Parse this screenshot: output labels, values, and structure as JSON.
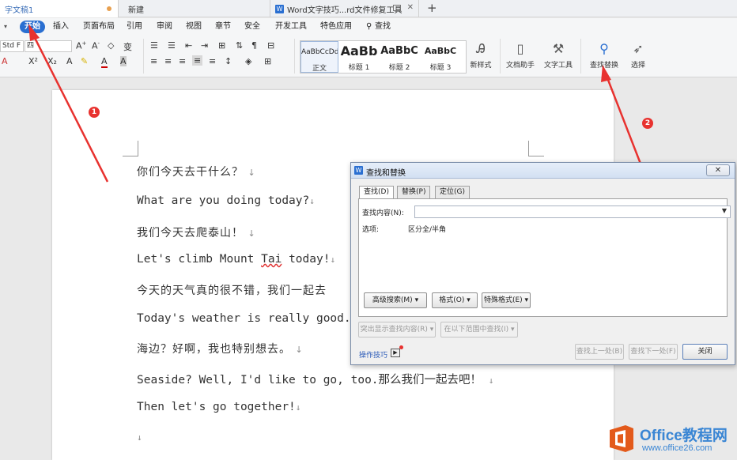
{
  "tabs": [
    {
      "label": "字文稿1",
      "active": true
    },
    {
      "label": "新建",
      "active": false
    },
    {
      "label": "Word文字技巧...rd文件修复工具",
      "active": false
    }
  ],
  "new_tab_glyph": "+",
  "menu": {
    "collapse_glyph": "▾",
    "items": [
      "开始",
      "插入",
      "页面布局",
      "引用",
      "审阅",
      "视图",
      "章节",
      "安全",
      "开发工具",
      "特色应用"
    ],
    "search_label": "查找"
  },
  "ribbon": {
    "font_name": "Std F",
    "font_size": "四",
    "styles": [
      {
        "preview": "AaBbCcDd",
        "name": "正文"
      },
      {
        "preview": "AaBb",
        "name": "标题 1"
      },
      {
        "preview": "AaBbC",
        "name": "标题 2"
      },
      {
        "preview": "AaBbC",
        "name": "标题 3"
      }
    ],
    "new_style_label": "新样式",
    "doc_helper_label": "文档助手",
    "text_tools_label": "文字工具",
    "find_replace_label": "查找替换",
    "select_label": "选择"
  },
  "document": {
    "lines": [
      {
        "text": "你们今天去干什么？",
        "cjk": true
      },
      {
        "text": "What are you doing today?",
        "cjk": false
      },
      {
        "text": "我们今天去爬泰山！",
        "cjk": true
      },
      {
        "text_before": "Let's climb Mount ",
        "squiggle": "Tai",
        "text_after": " today!"
      },
      {
        "text": "今天的天气真的很不错，我们一起去",
        "cjk": true
      },
      {
        "text": "Today's weather is really good. L",
        "cjk": false
      },
      {
        "text": "海边？好啊，我也特别想去。",
        "cjk": true
      },
      {
        "text": "Seaside? Well, I'd like to go, too.那么我们一起去吧！",
        "cjk": false
      },
      {
        "text": "Then let's go together!",
        "cjk": false
      },
      {
        "text": "",
        "cjk": false
      }
    ],
    "para_mark": "↓"
  },
  "annotations": {
    "badge1": "1",
    "badge2": "2"
  },
  "dialog": {
    "title": "查找和替换",
    "close_glyph": "✕",
    "tabs": [
      "查找(D)",
      "替换(P)",
      "定位(G)"
    ],
    "find_label": "查找内容(N):",
    "find_value": "",
    "options_label": "选项:",
    "options_value": "区分全/半角",
    "buttons": {
      "advanced": "高级搜索(M)",
      "format": "格式(O)",
      "special": "特殊格式(E)",
      "highlight": "突出显示查找内容(R)",
      "find_in": "在以下范围中查找(I)",
      "find_prev": "查找上一处(B)",
      "find_next": "查找下一处(F)",
      "close": "关闭"
    },
    "tips_link": "操作技巧"
  },
  "watermark": {
    "line1": "Office教程网",
    "line2": "www.office26.com"
  },
  "colors": {
    "accent": "#2a6fd1",
    "arrow": "#e8322f",
    "watermark": "#3a86d4"
  }
}
